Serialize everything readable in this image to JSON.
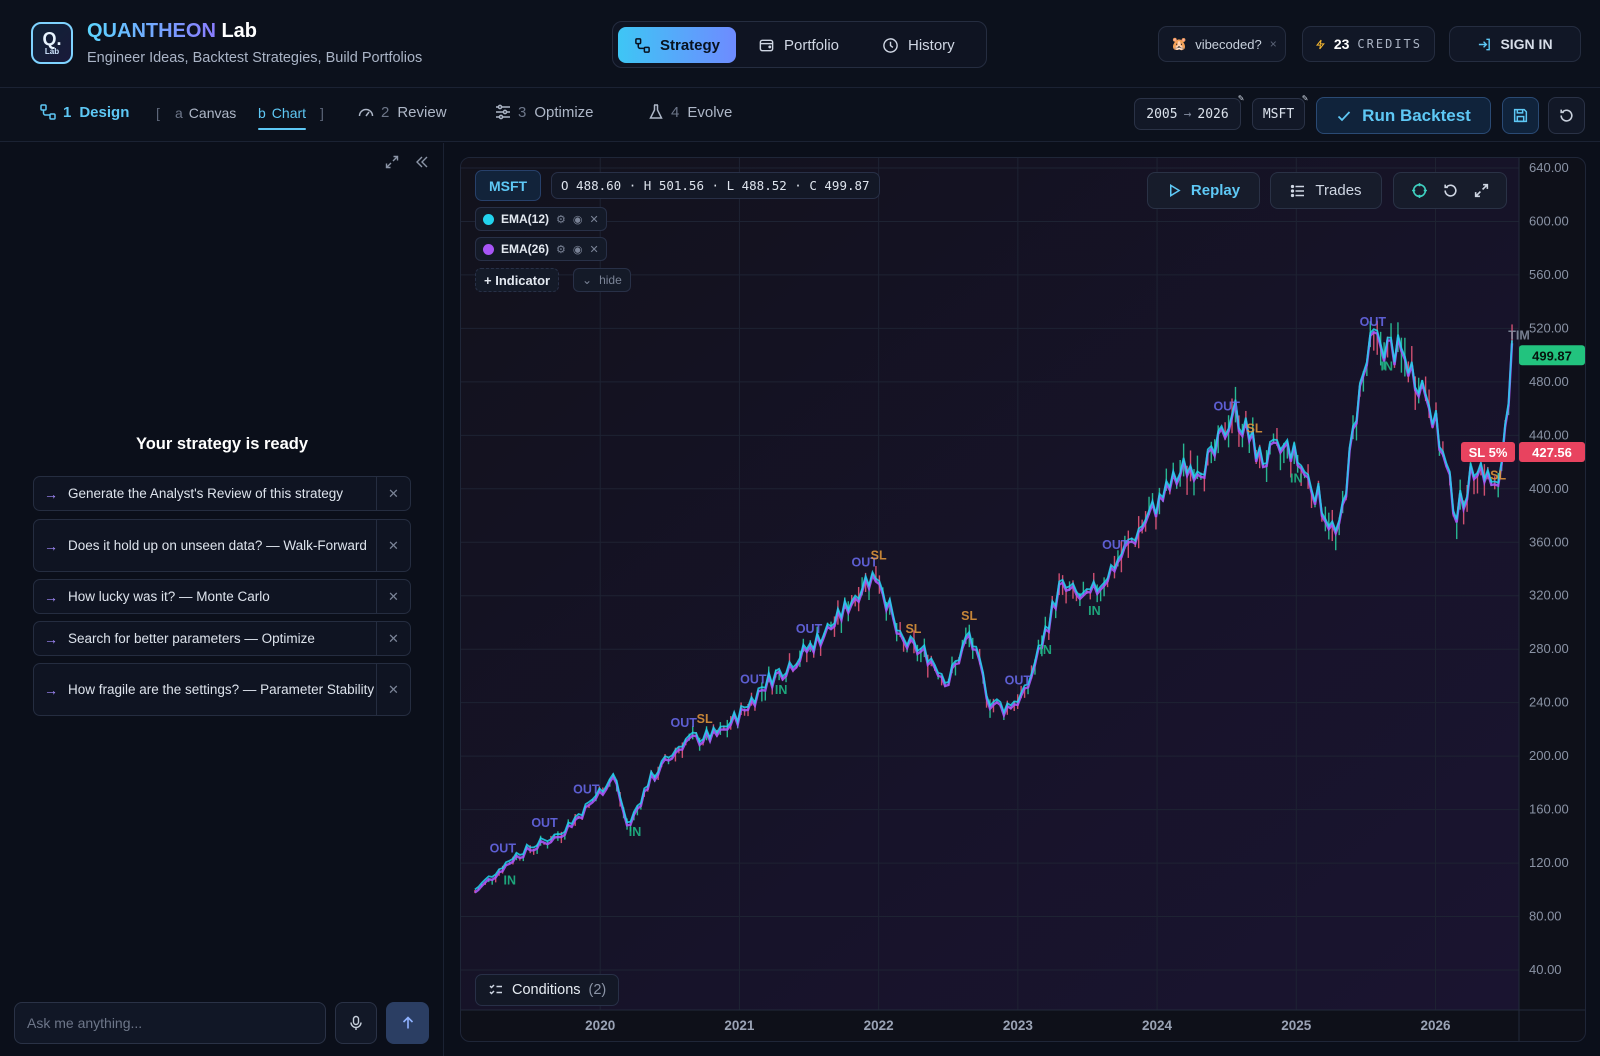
{
  "header": {
    "brand_q": "QUANTHEON",
    "brand_rest": " Lab",
    "subtitle": "Engineer Ideas, Backtest Strategies, Build Portfolios",
    "logo_q": "Q.",
    "logo_lab": "Lab",
    "modes": [
      {
        "label": "Strategy",
        "icon": "strategy-icon",
        "active": true
      },
      {
        "label": "Portfolio",
        "icon": "wallet-icon",
        "active": false
      },
      {
        "label": "History",
        "icon": "clock-icon",
        "active": false
      }
    ],
    "vibe": {
      "emoji": "🐹",
      "label": "vibecoded?",
      "close": "×"
    },
    "credits": {
      "count": "23",
      "label": "CREDITS"
    },
    "sign_in": "SIGN IN"
  },
  "steps": {
    "design": {
      "num": "1",
      "label": "Design"
    },
    "subs": [
      {
        "key": "a",
        "label": "Canvas"
      },
      {
        "key": "b",
        "label": "Chart"
      }
    ],
    "review": {
      "num": "2",
      "label": "Review"
    },
    "optimize": {
      "num": "3",
      "label": "Optimize"
    },
    "evolve": {
      "num": "4",
      "label": "Evolve"
    },
    "bracket_open": "[",
    "bracket_close": "]"
  },
  "controls": {
    "date_from": "2005",
    "date_arrow": "→",
    "date_to": "2026",
    "ticker": "MSFT",
    "run_label": "Run Backtest"
  },
  "left": {
    "ready_title": "Your strategy is ready",
    "suggestions": [
      "Generate the Analyst's Review of this strategy",
      "Does it hold up on unseen data? — Walk-Forward",
      "How lucky was it? — Monte Carlo",
      "Search for better parameters — Optimize",
      "How fragile are the settings? — Parameter Stability"
    ],
    "ask_placeholder": "Ask me anything..."
  },
  "chart": {
    "ticker": "MSFT",
    "ohlc": "O 488.60 · H 501.56 · L 488.52 · C 499.87",
    "replay": "Replay",
    "trades": "Trades",
    "indicators": [
      {
        "label": "EMA(12)",
        "color": "#22d3ee"
      },
      {
        "label": "EMA(26)",
        "color": "#a855f7"
      }
    ],
    "add_indicator": "+ Indicator",
    "hide": "hide",
    "conditions_label": "Conditions",
    "conditions_count": "(2)",
    "last_price_label": "499.87",
    "stop_label": "SL 5%",
    "stop_price": "427.56",
    "marker_labels": {
      "in": "IN",
      "out": "OUT",
      "sl": "SL",
      "tim": "TIM"
    }
  },
  "chart_data": {
    "type": "line",
    "y_ticks": [
      40,
      80,
      120,
      160,
      200,
      240,
      280,
      320,
      360,
      400,
      440,
      480,
      520,
      560,
      600,
      640
    ],
    "x_ticks": [
      "2020",
      "2021",
      "2022",
      "2023",
      "2024",
      "2025",
      "2026"
    ],
    "ylim": [
      20,
      660
    ],
    "x": [
      2019.1,
      2019.4,
      2019.7,
      2019.9,
      2020.1,
      2020.2,
      2020.35,
      2020.6,
      2020.85,
      2021.0,
      2021.2,
      2021.45,
      2021.7,
      2021.9,
      2022.0,
      2022.15,
      2022.35,
      2022.5,
      2022.65,
      2022.8,
      2022.9,
      2023.05,
      2023.3,
      2023.5,
      2023.75,
      2023.95,
      2024.2,
      2024.4,
      2024.55,
      2024.75,
      2024.95,
      2025.15,
      2025.3,
      2025.45,
      2025.55,
      2025.75,
      2025.95,
      2026.15,
      2026.3,
      2026.45,
      2026.55
    ],
    "series": [
      {
        "values": [
          98,
          125,
          140,
          160,
          185,
          145,
          180,
          210,
          215,
          230,
          255,
          275,
          300,
          330,
          335,
          285,
          275,
          255,
          290,
          240,
          235,
          245,
          325,
          315,
          350,
          380,
          415,
          420,
          460,
          420,
          430,
          395,
          360,
          470,
          510,
          500,
          470,
          380,
          420,
          395,
          499.87
        ]
      }
    ],
    "stop_loss": 427.56,
    "last_price": 499.87
  }
}
